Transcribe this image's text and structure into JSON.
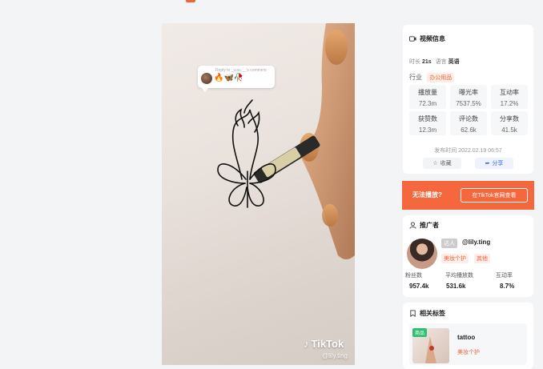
{
  "video": {
    "comment_reply": "Reply to _cucc__'s comment",
    "comment_emojis": "🔥🦋🥀",
    "brand": "TikTok",
    "handle": "@lily.ting"
  },
  "info": {
    "title": "视频信息",
    "duration_label": "时长",
    "duration_value": "21s",
    "language_label": "语言",
    "language_value": "英语",
    "industry_label": "行业",
    "industry_tag": "办公用品",
    "stats": [
      {
        "label": "播放量",
        "value": "72.3m"
      },
      {
        "label": "曝光率",
        "value": "7537.5%"
      },
      {
        "label": "互动率",
        "value": "17.2%"
      },
      {
        "label": "获赞数",
        "value": "12.3m"
      },
      {
        "label": "评论数",
        "value": "62.6k"
      },
      {
        "label": "分享数",
        "value": "41.5k"
      }
    ],
    "publish_time": "发布时间 2022.02.19 06:57",
    "favorite_label": "收藏",
    "share_label": "分享"
  },
  "banner": {
    "text": "无法播放?",
    "button": "在TikTok官网查看"
  },
  "promoter": {
    "title": "推广者",
    "badge": "达人",
    "name": "@lily.ting",
    "tags": [
      "美妆个护",
      "其他"
    ],
    "stats": [
      {
        "label": "粉丝数",
        "value": "957.4k"
      },
      {
        "label": "平均播放数",
        "value": "531.6k"
      },
      {
        "label": "互动率",
        "value": "8.7%"
      }
    ]
  },
  "tags": {
    "title": "相关标签",
    "item_badge": "商品",
    "item_name": "tattoo",
    "item_category": "美妆个护"
  },
  "colors": {
    "accent": "#f5683d",
    "share_blue": "#3b6fe0",
    "tag_green": "#2fbf71"
  }
}
